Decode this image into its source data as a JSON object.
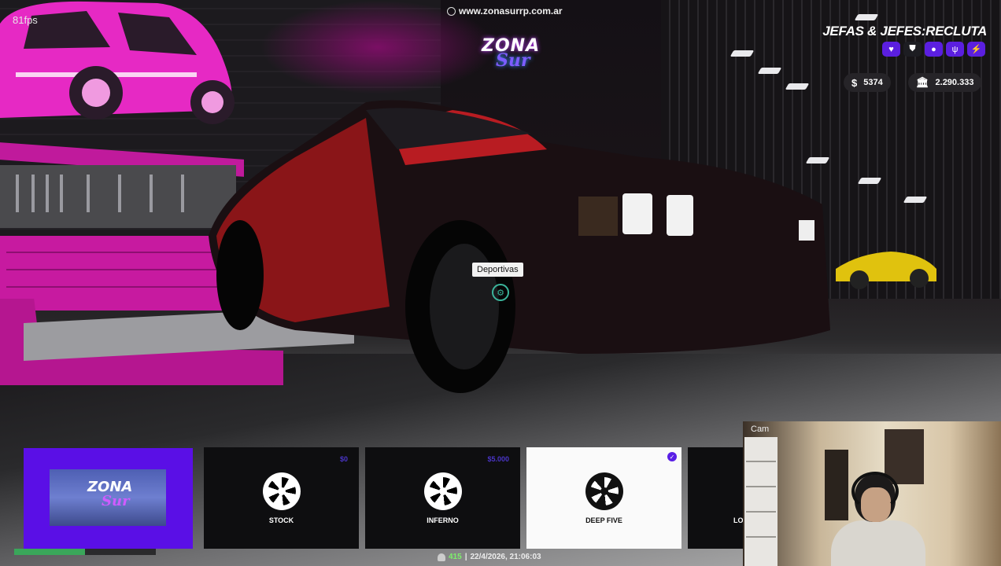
{
  "hud": {
    "fps": "81fps",
    "website": "www.zonasurrp.com.ar",
    "logo": {
      "line1": "ZONA",
      "line2": "Sur"
    },
    "job": "JEFAS & JEFES:RECLUTA",
    "status_icons": [
      "heart-icon",
      "shield-icon",
      "water-drop-icon",
      "food-icon",
      "stamina-icon"
    ],
    "cash": {
      "symbol": "$",
      "amount": "5374"
    },
    "bank": {
      "symbol": "🏛",
      "amount": "2.290.333"
    },
    "tooltip": "Deportivas",
    "footer": {
      "players": "415",
      "separator": "|",
      "datetime": "22/4/2026, 21:06:03"
    }
  },
  "selector": {
    "preview_logo": {
      "line1": "ZONA",
      "line2": "Sur"
    },
    "cards": [
      {
        "label": "STOCK",
        "price": "$0",
        "selected": false
      },
      {
        "label": "INFERNO",
        "price": "$5.000",
        "selected": false
      },
      {
        "label": "DEEP FIVE",
        "price": "",
        "selected": true
      },
      {
        "label": "LO",
        "price": "",
        "selected": false
      }
    ],
    "progress": 0.5
  },
  "webcam": {
    "label": "Cam"
  },
  "colors": {
    "accent": "#5a0fe6",
    "pink": "#c71aa0",
    "money_bg": "#262428",
    "card_bg": "#0e0e10"
  }
}
